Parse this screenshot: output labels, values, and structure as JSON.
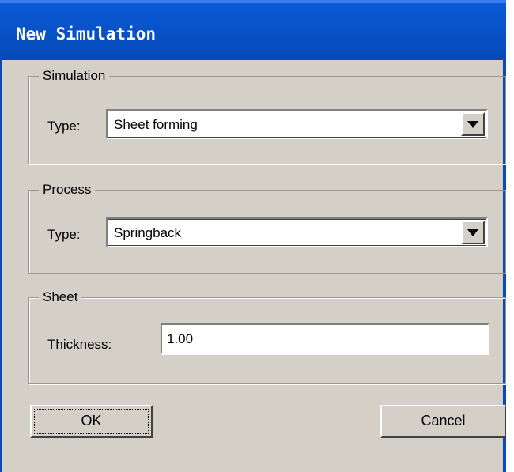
{
  "window": {
    "title": "New Simulation"
  },
  "simulation": {
    "legend": "Simulation",
    "type_label": "Type:",
    "type_value": "Sheet forming"
  },
  "process": {
    "legend": "Process",
    "type_label": "Type:",
    "type_value": "Springback"
  },
  "sheet": {
    "legend": "Sheet",
    "thickness_label": "Thickness:",
    "thickness_value": "1.00"
  },
  "buttons": {
    "ok_label": "OK",
    "cancel_label": "Cancel"
  },
  "icons": {
    "dropdown": "chevron-down-icon"
  }
}
